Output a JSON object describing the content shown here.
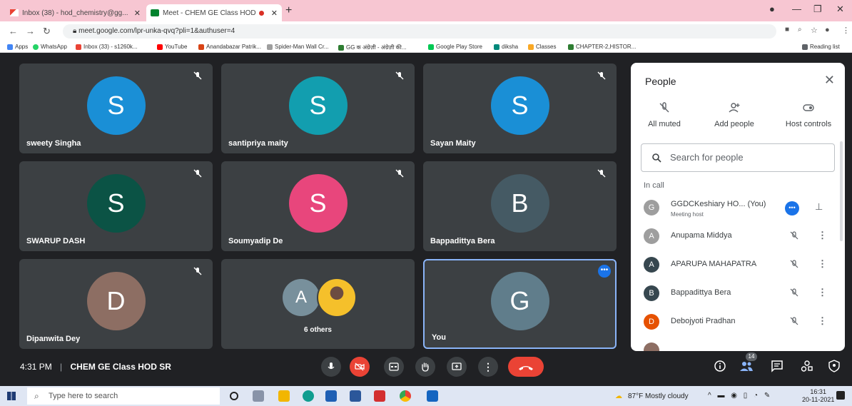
{
  "browser": {
    "tabs": [
      {
        "title": "Inbox (38) - hod_chemistry@gg..."
      },
      {
        "title": "Meet - CHEM GE Class HOD"
      }
    ],
    "new_tab": "+",
    "url": "meet.google.com/lpr-unka-qvq?pli=1&authuser=4",
    "bookmarks": [
      "Apps",
      "WhatsApp",
      "Inbox (33) - s1260k...",
      "YouTube",
      "Anandabazar Patrik...",
      "Spider-Man Wall Cr...",
      "GG क अंग्रेज़ी - अंग्रेज़ी की...",
      "Google Play Store",
      "diksha",
      "Classes",
      "CHAPTER-2,HISTOR..."
    ],
    "reading_list": "Reading list"
  },
  "tiles": [
    {
      "name": "sweety Singha",
      "initial": "S",
      "color": "#1a8fd6"
    },
    {
      "name": "santipriya maity",
      "initial": "S",
      "color": "#129eaf"
    },
    {
      "name": "Sayan Maity",
      "initial": "S",
      "color": "#1a8fd6"
    },
    {
      "name": "SWARUP DASH",
      "initial": "S",
      "color": "#0b5345"
    },
    {
      "name": "Soumyadip De",
      "initial": "S",
      "color": "#e8467c"
    },
    {
      "name": "Bappadittya Bera",
      "initial": "B",
      "color": "#455a64"
    },
    {
      "name": "Dipanwita Dey",
      "initial": "D",
      "color": "#8d6e63"
    },
    {
      "name": "6 others",
      "initial": "A",
      "color": "#78909c"
    },
    {
      "name": "You",
      "initial": "G",
      "color": "#607d8b"
    }
  ],
  "people": {
    "title": "People",
    "actions": [
      "All muted",
      "Add people",
      "Host controls"
    ],
    "search_placeholder": "Search for people",
    "section": "In call",
    "rows": [
      {
        "initial": "G",
        "name": "GGDCKeshiary HO...  (You)",
        "sub": "Meeting host",
        "color": "#9e9e9e"
      },
      {
        "initial": "A",
        "name": "Anupama Middya",
        "color": "#9e9e9e"
      },
      {
        "initial": "A",
        "name": "APARUPA MAHAPATRA",
        "color": "#37474f"
      },
      {
        "initial": "B",
        "name": "Bappadittya Bera",
        "color": "#37474f"
      },
      {
        "initial": "D",
        "name": "Debojyoti Pradhan",
        "color": "#e65100"
      }
    ]
  },
  "controls": {
    "time": "4:31 PM",
    "separator": "|",
    "meeting_title": "CHEM GE Class HOD SR",
    "participants_badge": "14"
  },
  "taskbar": {
    "search_placeholder": "Type here to search",
    "weather": "87°F  Mostly cloudy",
    "time": "16:31",
    "date": "20-11-2021"
  }
}
